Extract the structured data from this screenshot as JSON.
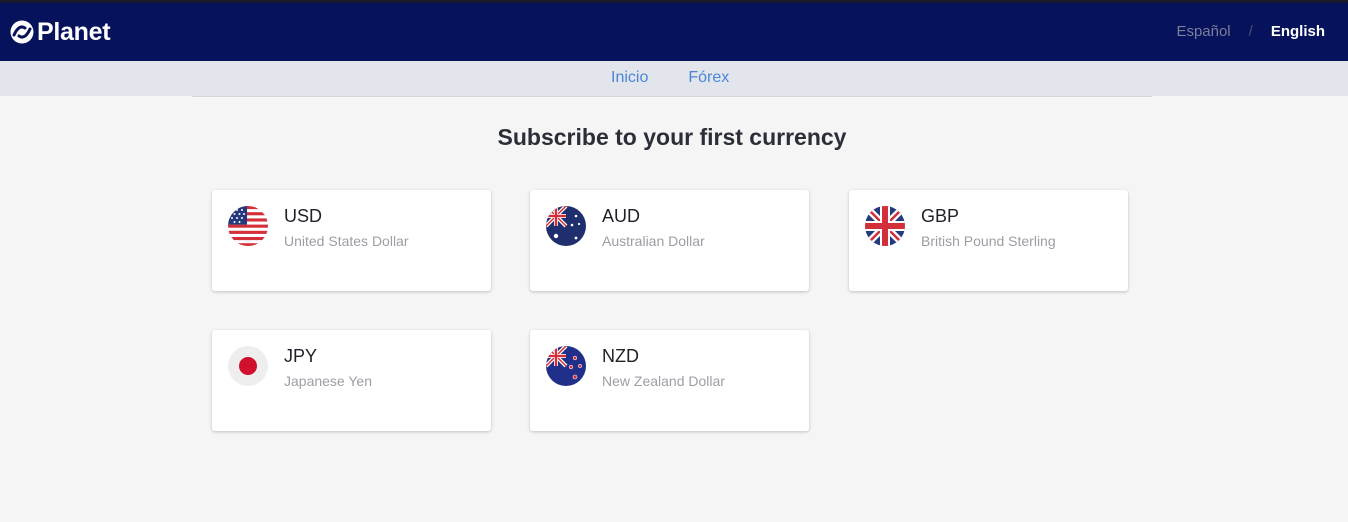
{
  "header": {
    "logo_text": "Planet",
    "languages": [
      {
        "label": "Español",
        "active": false
      },
      {
        "label": "English",
        "active": true
      }
    ],
    "separator": "/"
  },
  "subnav": {
    "items": [
      {
        "label": "Inicio"
      },
      {
        "label": "Fórex"
      }
    ]
  },
  "main": {
    "title": "Subscribe to your first currency",
    "currencies": [
      {
        "code": "USD",
        "name": "United States Dollar",
        "icon": "us-flag-icon"
      },
      {
        "code": "AUD",
        "name": "Australian Dollar",
        "icon": "australia-flag-icon"
      },
      {
        "code": "GBP",
        "name": "British Pound Sterling",
        "icon": "uk-flag-icon"
      },
      {
        "code": "JPY",
        "name": "Japanese Yen",
        "icon": "japan-flag-icon"
      },
      {
        "code": "NZD",
        "name": "New Zealand Dollar",
        "icon": "new-zealand-flag-icon"
      }
    ]
  },
  "colors": {
    "header_bg": "#06125c",
    "subnav_bg": "#e2e5ec",
    "link": "#4a86d6",
    "page_bg": "#f5f5f5"
  }
}
